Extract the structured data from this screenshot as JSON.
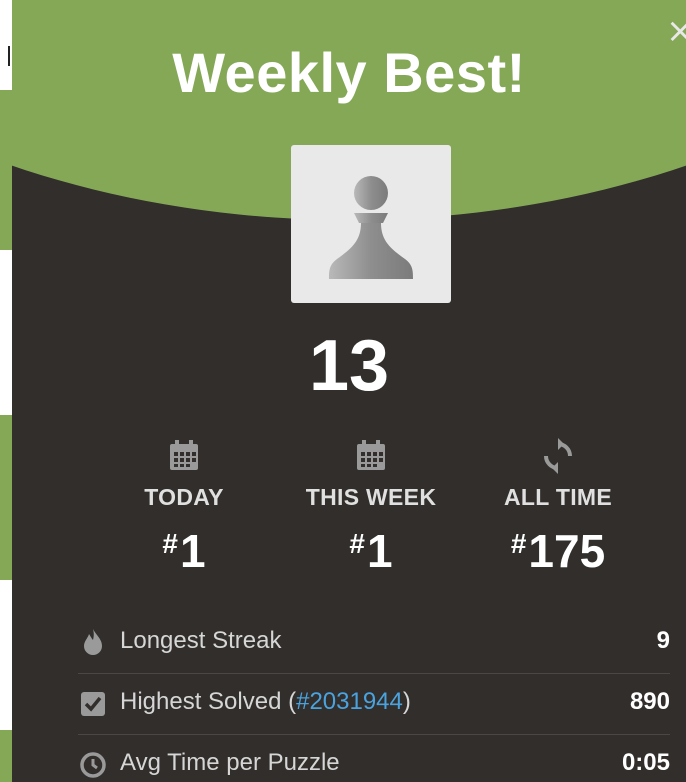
{
  "modal": {
    "title": "Weekly Best!",
    "close_symbol": "×",
    "avatar_icon": "pawn-icon",
    "score": "13"
  },
  "ranks": [
    {
      "label": "TODAY",
      "hash": "#",
      "value": "1",
      "icon": "calendar-icon"
    },
    {
      "label": "THIS WEEK",
      "hash": "#",
      "value": "1",
      "icon": "calendar-icon"
    },
    {
      "label": "ALL TIME",
      "hash": "#",
      "value": "175",
      "icon": "refresh-icon"
    }
  ],
  "stats": {
    "longest_streak": {
      "label": "Longest Streak",
      "value": "9",
      "icon": "flame-icon"
    },
    "highest_solved": {
      "label_prefix": "Highest Solved (",
      "link": "#2031944",
      "label_suffix": ")",
      "value": "890",
      "icon": "checkbox-icon"
    },
    "avg_time": {
      "label": "Avg Time per Puzzle",
      "value": "0:05",
      "icon": "clock-icon"
    }
  },
  "colors": {
    "header_green": "#85a857",
    "modal_bg": "#312e2b",
    "link_blue": "#4aa3df"
  }
}
